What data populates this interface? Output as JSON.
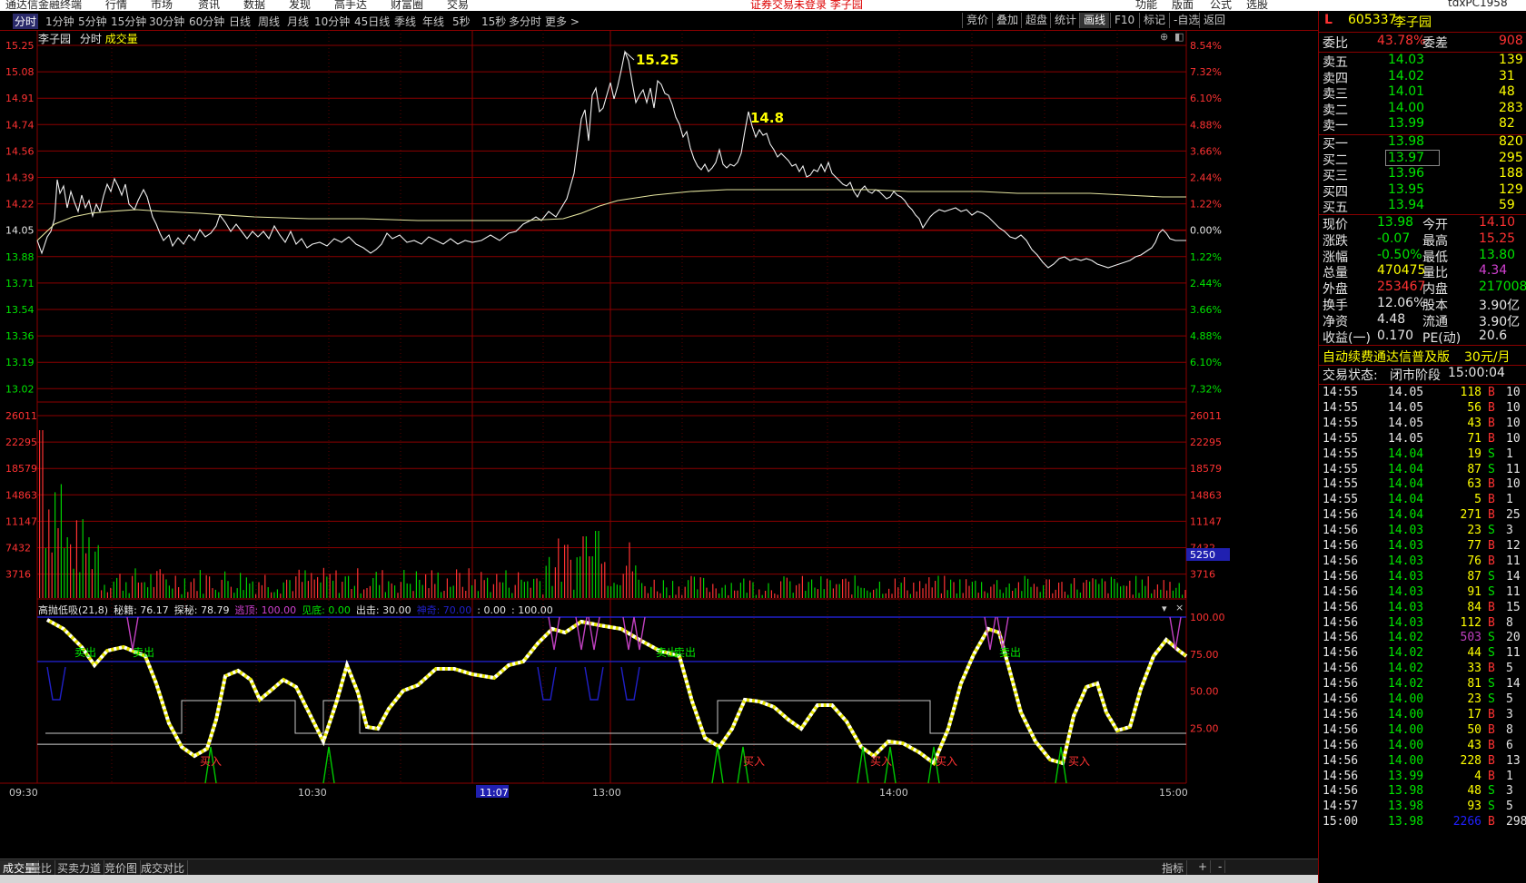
{
  "top_menu": [
    "通达信金融终端",
    "行情",
    "市场",
    "资讯",
    "数据",
    "发现",
    "高手达",
    "财富圈",
    "交易"
  ],
  "top_menu_center": "证券交易未登录 李子园",
  "top_menu_right": [
    "功能",
    "版面",
    "公式",
    "选股",
    "tdxPC1958"
  ],
  "periods": [
    "分时",
    "1分钟",
    "5分钟",
    "15分钟",
    "30分钟",
    "60分钟",
    "日线",
    "周线",
    "月线",
    "10分钟",
    "45日线",
    "季线",
    "年线",
    "5秒",
    "15秒",
    "多分时",
    "更多 >"
  ],
  "active_period": 0,
  "right_tools": [
    "竞价",
    "叠加",
    "超盘",
    "统计",
    "画线",
    "F10",
    "标记",
    "-自选",
    "返回"
  ],
  "active_tool": 4,
  "chart_header": {
    "stock": "李子园",
    "mode": "分时",
    "indicator": "成交量"
  },
  "price_axis_left": [
    "15.25",
    "15.08",
    "14.91",
    "14.74",
    "14.56",
    "14.39",
    "14.22",
    "14.05",
    "13.88",
    "13.71",
    "13.54",
    "13.36",
    "13.19",
    "13.02"
  ],
  "pct_axis_right": [
    "8.54%",
    "7.32%",
    "6.10%",
    "4.88%",
    "3.66%",
    "2.44%",
    "1.22%",
    "0.00%",
    "1.22%",
    "2.44%",
    "3.66%",
    "4.88%",
    "6.10%",
    "7.32%"
  ],
  "vol_axis": [
    "26011",
    "22295",
    "18579",
    "14863",
    "11147",
    "7432",
    "3716"
  ],
  "vol_current_label": "5250",
  "annotations": {
    "high": "15.25",
    "second_high": "14.8"
  },
  "indicator": {
    "name": "高抛低吸(21,8)",
    "parts": [
      {
        "t": "秘籍: 76.17",
        "c": "#e6e6e6"
      },
      {
        "t": "探秘: 78.79",
        "c": "#e6e6e6"
      },
      {
        "t": "逃顶: 100.00",
        "c": "#d040d0"
      },
      {
        "t": "见底: 0.00",
        "c": "#00e600"
      },
      {
        "t": "出击: 30.00",
        "c": "#e6e6e6"
      },
      {
        "t": "神奇: 70.00",
        "c": "#2020c8"
      },
      {
        "t": ": 0.00",
        "c": "#e6e6e6"
      },
      {
        "t": ": 100.00",
        "c": "#e6e6e6"
      }
    ],
    "axis": [
      "100.00",
      "75.00",
      "50.00",
      "25.00"
    ],
    "sell_label": "卖出",
    "buy_label": "买入"
  },
  "time_axis": [
    "09:30",
    "10:30",
    "11:07",
    "13:00",
    "14:00",
    "15:00"
  ],
  "bottom_tabs": [
    "成交量",
    "量比",
    "买卖力道",
    "竞价图",
    "成交对比"
  ],
  "bottom_right": [
    "指标",
    "+",
    "-"
  ],
  "quote": {
    "market_flag": "L",
    "code": "605337",
    "name": "李子园",
    "weibi_label": "委比",
    "weibi": "43.78%",
    "weicha_label": "委差",
    "weicha": "908",
    "sells": [
      {
        "label": "卖五",
        "price": "14.03",
        "vol": "139"
      },
      {
        "label": "卖四",
        "price": "14.02",
        "vol": "31"
      },
      {
        "label": "卖三",
        "price": "14.01",
        "vol": "48"
      },
      {
        "label": "卖二",
        "price": "14.00",
        "vol": "283"
      },
      {
        "label": "卖一",
        "price": "13.99",
        "vol": "82"
      }
    ],
    "buys": [
      {
        "label": "买一",
        "price": "13.98",
        "vol": "820"
      },
      {
        "label": "买二",
        "price": "13.97",
        "vol": "295"
      },
      {
        "label": "买三",
        "price": "13.96",
        "vol": "188"
      },
      {
        "label": "买四",
        "price": "13.95",
        "vol": "129"
      },
      {
        "label": "买五",
        "price": "13.94",
        "vol": "59"
      }
    ],
    "stats": [
      {
        "l1": "现价",
        "v1": "13.98",
        "c1": "#00e600",
        "l2": "今开",
        "v2": "14.10",
        "c2": "#ff3232"
      },
      {
        "l1": "涨跌",
        "v1": "-0.07",
        "c1": "#00e600",
        "l2": "最高",
        "v2": "15.25",
        "c2": "#ff3232"
      },
      {
        "l1": "涨幅",
        "v1": "-0.50%",
        "c1": "#00e600",
        "l2": "最低",
        "v2": "13.80",
        "c2": "#00e600"
      },
      {
        "l1": "总量",
        "v1": "470475",
        "c1": "#ffff00",
        "l2": "量比",
        "v2": "4.34",
        "c2": "#d040d0"
      },
      {
        "l1": "外盘",
        "v1": "253467",
        "c1": "#ff3232",
        "l2": "内盘",
        "v2": "217008",
        "c2": "#00e600"
      },
      {
        "l1": "换手",
        "v1": "12.06%",
        "c1": "#e6e6e6",
        "l2": "股本",
        "v2": "3.90亿",
        "c2": "#e6e6e6"
      },
      {
        "l1": "净资",
        "v1": "4.48",
        "c1": "#e6e6e6",
        "l2": "流通",
        "v2": "3.90亿",
        "c2": "#e6e6e6"
      },
      {
        "l1": "收益(一)",
        "v1": "0.170",
        "c1": "#e6e6e6",
        "l2": "PE(动)",
        "v2": "20.6",
        "c2": "#e6e6e6"
      }
    ],
    "promo": "自动续费通达信普及版",
    "promo_price": "30元/月",
    "trade_state_label": "交易状态:",
    "trade_state": "闭市阶段",
    "trade_time": "15:00:04"
  },
  "ticks": [
    {
      "t": "14:55",
      "p": "14.05",
      "pc": "#e6e6e6",
      "v": "118",
      "bs": "B",
      "n": "10"
    },
    {
      "t": "14:55",
      "p": "14.05",
      "pc": "#e6e6e6",
      "v": "56",
      "bs": "B",
      "n": "10"
    },
    {
      "t": "14:55",
      "p": "14.05",
      "pc": "#e6e6e6",
      "v": "43",
      "bs": "B",
      "n": "10"
    },
    {
      "t": "14:55",
      "p": "14.05",
      "pc": "#e6e6e6",
      "v": "71",
      "bs": "B",
      "n": "10"
    },
    {
      "t": "14:55",
      "p": "14.04",
      "pc": "#00e600",
      "v": "19",
      "bs": "S",
      "n": "1"
    },
    {
      "t": "14:55",
      "p": "14.04",
      "pc": "#00e600",
      "v": "87",
      "bs": "S",
      "n": "11"
    },
    {
      "t": "14:55",
      "p": "14.04",
      "pc": "#00e600",
      "v": "63",
      "bs": "B",
      "n": "10"
    },
    {
      "t": "14:55",
      "p": "14.04",
      "pc": "#00e600",
      "v": "5",
      "bs": "B",
      "n": "1"
    },
    {
      "t": "14:56",
      "p": "14.04",
      "pc": "#00e600",
      "v": "271",
      "bs": "B",
      "n": "25"
    },
    {
      "t": "14:56",
      "p": "14.03",
      "pc": "#00e600",
      "v": "23",
      "bs": "S",
      "n": "3"
    },
    {
      "t": "14:56",
      "p": "14.03",
      "pc": "#00e600",
      "v": "77",
      "bs": "B",
      "n": "12"
    },
    {
      "t": "14:56",
      "p": "14.03",
      "pc": "#00e600",
      "v": "76",
      "bs": "B",
      "n": "11"
    },
    {
      "t": "14:56",
      "p": "14.03",
      "pc": "#00e600",
      "v": "87",
      "bs": "S",
      "n": "14"
    },
    {
      "t": "14:56",
      "p": "14.03",
      "pc": "#00e600",
      "v": "91",
      "bs": "S",
      "n": "11"
    },
    {
      "t": "14:56",
      "p": "14.03",
      "pc": "#00e600",
      "v": "84",
      "bs": "B",
      "n": "15"
    },
    {
      "t": "14:56",
      "p": "14.03",
      "pc": "#00e600",
      "v": "112",
      "bs": "B",
      "n": "8"
    },
    {
      "t": "14:56",
      "p": "14.02",
      "pc": "#00e600",
      "v": "503",
      "bs": "S",
      "n": "20"
    },
    {
      "t": "14:56",
      "p": "14.02",
      "pc": "#00e600",
      "v": "44",
      "bs": "S",
      "n": "11"
    },
    {
      "t": "14:56",
      "p": "14.02",
      "pc": "#00e600",
      "v": "33",
      "bs": "B",
      "n": "5"
    },
    {
      "t": "14:56",
      "p": "14.02",
      "pc": "#00e600",
      "v": "81",
      "bs": "S",
      "n": "14"
    },
    {
      "t": "14:56",
      "p": "14.00",
      "pc": "#00e600",
      "v": "23",
      "bs": "S",
      "n": "5"
    },
    {
      "t": "14:56",
      "p": "14.00",
      "pc": "#00e600",
      "v": "17",
      "bs": "B",
      "n": "3"
    },
    {
      "t": "14:56",
      "p": "14.00",
      "pc": "#00e600",
      "v": "50",
      "bs": "B",
      "n": "8"
    },
    {
      "t": "14:56",
      "p": "14.00",
      "pc": "#00e600",
      "v": "43",
      "bs": "B",
      "n": "6"
    },
    {
      "t": "14:56",
      "p": "14.00",
      "pc": "#00e600",
      "v": "228",
      "bs": "B",
      "n": "13"
    },
    {
      "t": "14:56",
      "p": "13.99",
      "pc": "#00e600",
      "v": "4",
      "bs": "B",
      "n": "1"
    },
    {
      "t": "14:56",
      "p": "13.98",
      "pc": "#00e600",
      "v": "48",
      "bs": "S",
      "n": "3"
    },
    {
      "t": "14:57",
      "p": "13.98",
      "pc": "#00e600",
      "v": "93",
      "bs": "S",
      "n": "5"
    },
    {
      "t": "15:00",
      "p": "13.98",
      "pc": "#00e600",
      "v": "2266",
      "bs": "B",
      "n": "298"
    }
  ]
}
